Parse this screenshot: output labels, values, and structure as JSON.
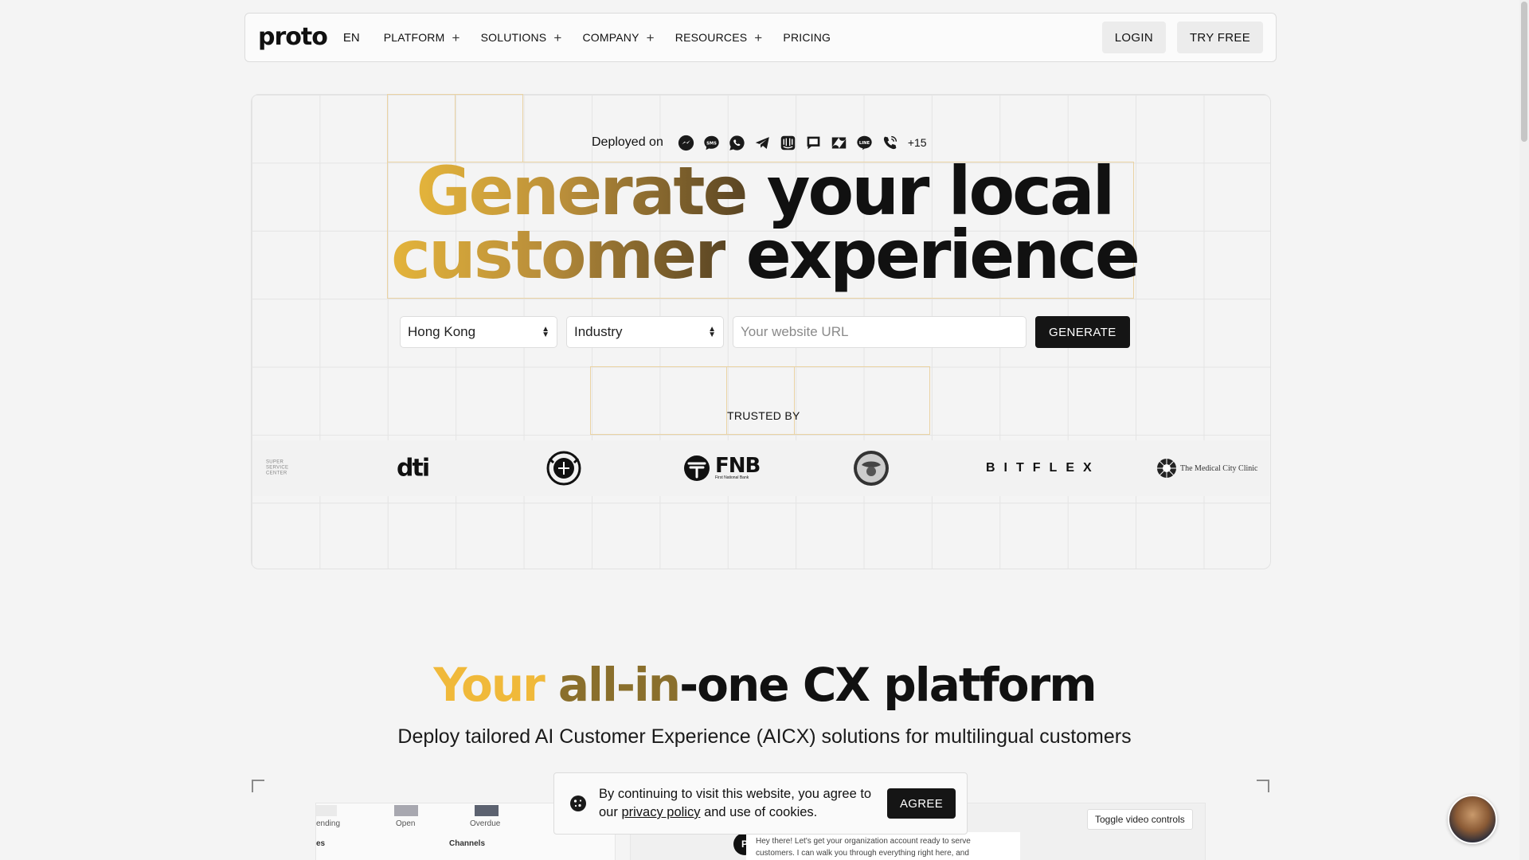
{
  "nav": {
    "logo": "proto",
    "lang": "EN",
    "items": [
      {
        "label": "PLATFORM",
        "has_menu": true
      },
      {
        "label": "SOLUTIONS",
        "has_menu": true
      },
      {
        "label": "COMPANY",
        "has_menu": true
      },
      {
        "label": "RESOURCES",
        "has_menu": true
      },
      {
        "label": "PRICING",
        "has_menu": false
      }
    ],
    "login": "LOGIN",
    "try_free": "TRY FREE"
  },
  "hero": {
    "deployed_label": "Deployed on",
    "channels": [
      "messenger-icon",
      "sms-icon",
      "whatsapp-icon",
      "telegram-icon",
      "intercom-icon",
      "chat-icon",
      "zendesk-icon",
      "line-icon",
      "phone-icon"
    ],
    "channels_more": "+15",
    "headline": {
      "line1_highlight": "Generate",
      "line1_rest": " your local",
      "line2_highlight": "customer",
      "line2_rest": " experience"
    },
    "country_select": "Hong Kong",
    "industry_select": "Industry",
    "url_placeholder": "Your website URL",
    "generate": "GENERATE",
    "trusted_by": "TRUSTED BY",
    "logos": {
      "ssc": "SUPER SERVICE CENTER",
      "dti": "dti",
      "fnb": "FNB",
      "fnb_sub": "First National Bank",
      "bitflex": "BITFLEX",
      "medical": "The Medical City Clinic"
    }
  },
  "section": {
    "title_part1": "Your ",
    "title_part2": "all-in",
    "title_part3": "-one CX platform",
    "subtitle": "Deploy tailored AI Customer Experience (AICX) solutions for multilingual customers"
  },
  "preview": {
    "bar_labels": [
      "ending",
      "Open",
      "Overdue"
    ],
    "channels_label": "Channels",
    "row_label": "es",
    "chat_text": "Hey there! Let's get your organization account ready to serve customers. I can walk you through everything right here, and",
    "toggle_video": "Toggle video controls"
  },
  "cookie": {
    "text_before": "By continuing to visit this website, you agree to our ",
    "link": "privacy policy",
    "text_after": " and use of cookies.",
    "agree": "AGREE"
  },
  "colors": {
    "gold": "#f0b93a",
    "gold_dark": "#8a6f2c",
    "dark_button": "#151515",
    "grid_highlight": "#ead3a4"
  }
}
